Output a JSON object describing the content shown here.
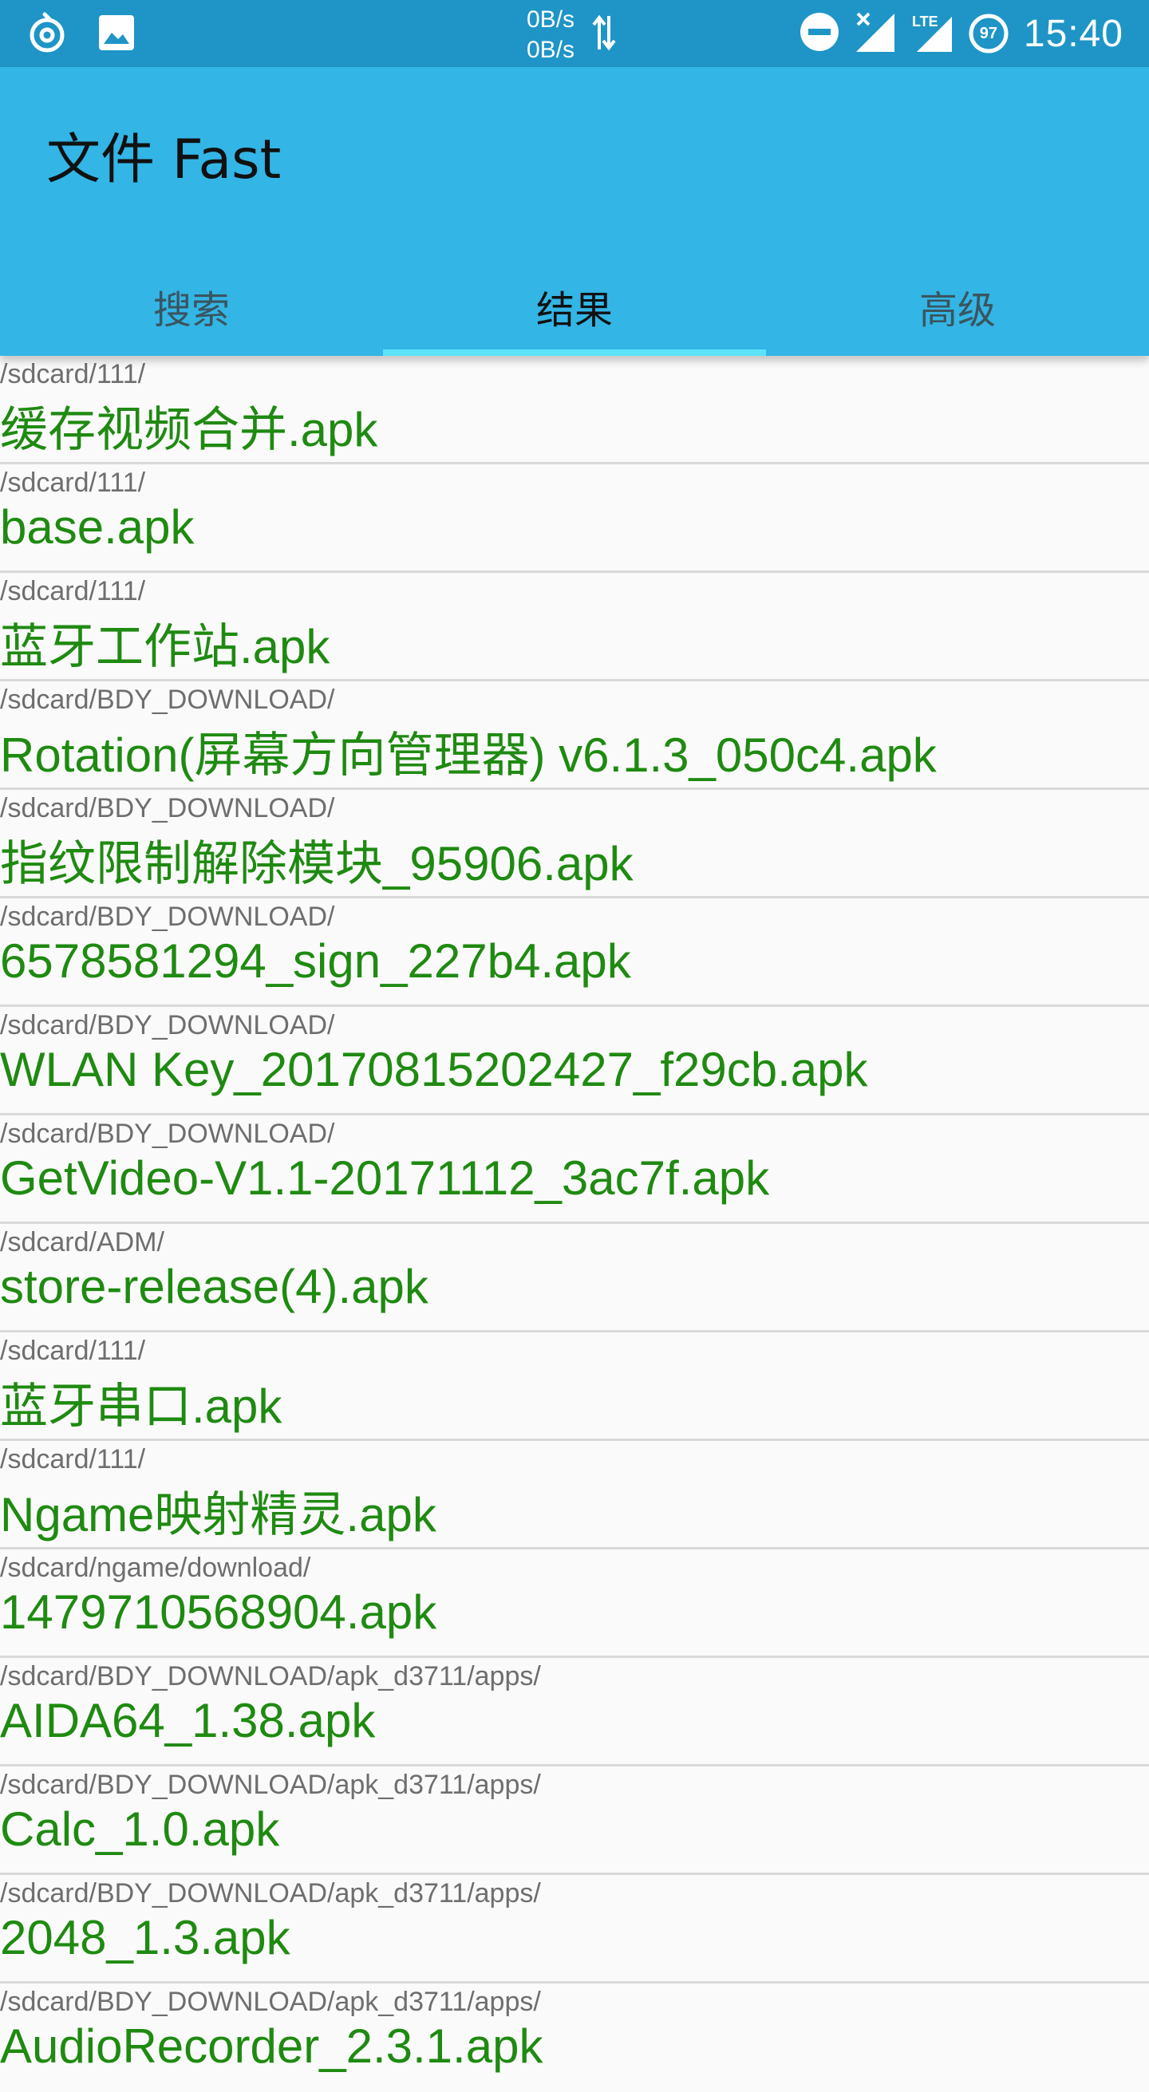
{
  "status_bar": {
    "net_up": "0B/s",
    "net_down": "0B/s",
    "lte": "LTE",
    "battery": "97",
    "time": "15:40"
  },
  "app": {
    "title": "文件 Fast"
  },
  "tabs": [
    {
      "label": "搜索",
      "active": false
    },
    {
      "label": "结果",
      "active": true
    },
    {
      "label": "高级",
      "active": false
    }
  ],
  "results": [
    {
      "path": "/sdcard/111/",
      "name": "缓存视频合并.apk"
    },
    {
      "path": "/sdcard/111/",
      "name": "base.apk"
    },
    {
      "path": "/sdcard/111/",
      "name": "蓝牙工作站.apk"
    },
    {
      "path": "/sdcard/BDY_DOWNLOAD/",
      "name": "Rotation(屏幕方向管理器) v6.1.3_050c4.apk"
    },
    {
      "path": "/sdcard/BDY_DOWNLOAD/",
      "name": "指纹限制解除模块_95906.apk"
    },
    {
      "path": "/sdcard/BDY_DOWNLOAD/",
      "name": "6578581294_sign_227b4.apk"
    },
    {
      "path": "/sdcard/BDY_DOWNLOAD/",
      "name": "WLAN Key_20170815202427_f29cb.apk"
    },
    {
      "path": "/sdcard/BDY_DOWNLOAD/",
      "name": "GetVideo-V1.1-20171112_3ac7f.apk"
    },
    {
      "path": "/sdcard/ADM/",
      "name": "store-release(4).apk"
    },
    {
      "path": "/sdcard/111/",
      "name": "蓝牙串口.apk"
    },
    {
      "path": "/sdcard/111/",
      "name": "Ngame映射精灵.apk"
    },
    {
      "path": "/sdcard/ngame/download/",
      "name": "1479710568904.apk"
    },
    {
      "path": "/sdcard/BDY_DOWNLOAD/apk_d3711/apps/",
      "name": "AIDA64_1.38.apk"
    },
    {
      "path": "/sdcard/BDY_DOWNLOAD/apk_d3711/apps/",
      "name": "Calc_1.0.apk"
    },
    {
      "path": "/sdcard/BDY_DOWNLOAD/apk_d3711/apps/",
      "name": "2048_1.3.apk"
    },
    {
      "path": "/sdcard/BDY_DOWNLOAD/apk_d3711/apps/",
      "name": "AudioRecorder_2.3.1.apk"
    }
  ],
  "colors": {
    "status_bar": "#1e95c6",
    "app_bar": "#33b5e5",
    "tab_indicator": "#5ee3fb",
    "file_name": "#1f8a11",
    "file_path": "#6e6e6e"
  },
  "icons": {
    "status_left": [
      "notification-app-icon",
      "image-notification-icon"
    ],
    "status_right": [
      "do-not-disturb-icon",
      "no-sim-signal-icon",
      "lte-signal-icon",
      "battery-icon"
    ]
  }
}
